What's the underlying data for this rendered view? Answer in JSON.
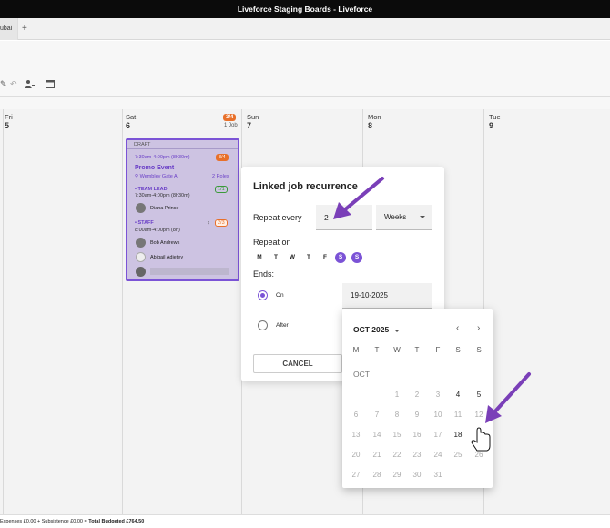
{
  "window": {
    "title": "Liveforce Staging Boards - Liveforce"
  },
  "tabs": {
    "first_tab": "ubai",
    "add_symbol": "+"
  },
  "calendar": {
    "columns": [
      {
        "day": "Fri",
        "date": "5"
      },
      {
        "day": "Sat",
        "date": "6",
        "badge": "3/4",
        "job_count": "1 Job"
      },
      {
        "day": "Sun",
        "date": "7"
      },
      {
        "day": "Mon",
        "date": "8"
      },
      {
        "day": "Tue",
        "date": "9"
      }
    ]
  },
  "job_card": {
    "status": "DRAFT",
    "time": "7:30am-4:00pm (8h30m)",
    "badge": "3/4",
    "title": "Promo Event",
    "location": "Wembley Gate A",
    "roles": "2 Roles",
    "team_lead": {
      "label": "• TEAM LEAD",
      "count": "1/1",
      "time": "7:30am-4:00pm (8h30m)",
      "people": [
        "Diana Prince"
      ]
    },
    "staff": {
      "label": "• STAFF",
      "count": "2/3",
      "time": "8:00am-4:00pm (8h)",
      "people": [
        "Bob Andrews",
        "Abigail Adjetey"
      ]
    }
  },
  "footer": {
    "text": "Expenses £0.00 + Subsistence £0.00 = ",
    "total": "Total Budgeted £764.50"
  },
  "modal": {
    "title": "Linked job recurrence",
    "repeat_every_label": "Repeat every",
    "repeat_every_value": "2",
    "unit": "Weeks",
    "repeat_on_label": "Repeat on",
    "days": [
      {
        "letter": "M",
        "on": false
      },
      {
        "letter": "T",
        "on": false
      },
      {
        "letter": "W",
        "on": false
      },
      {
        "letter": "T",
        "on": false
      },
      {
        "letter": "F",
        "on": false
      },
      {
        "letter": "S",
        "on": true
      },
      {
        "letter": "S",
        "on": true
      }
    ],
    "ends_label": "Ends:",
    "on_label": "On",
    "after_label": "After",
    "end_date": "19-10-2025",
    "cancel_label": "CANCEL"
  },
  "datepicker": {
    "month_label": "OCT 2025",
    "section_label": "OCT",
    "weekdays": [
      "M",
      "T",
      "W",
      "T",
      "F",
      "S",
      "S"
    ],
    "selected": "19",
    "enabled": [
      "4",
      "5",
      "18",
      "19"
    ],
    "weeks": [
      [
        "",
        "",
        "1",
        "2",
        "3",
        "4",
        "5"
      ],
      [
        "6",
        "7",
        "8",
        "9",
        "10",
        "11",
        "12"
      ],
      [
        "13",
        "14",
        "15",
        "16",
        "17",
        "18",
        "19"
      ],
      [
        "20",
        "21",
        "22",
        "23",
        "24",
        "25",
        "26"
      ],
      [
        "27",
        "28",
        "29",
        "30",
        "31",
        "",
        ""
      ]
    ]
  },
  "colors": {
    "accent": "#7b53d6",
    "orange": "#e8702a",
    "annotation": "#7a3fb8"
  }
}
